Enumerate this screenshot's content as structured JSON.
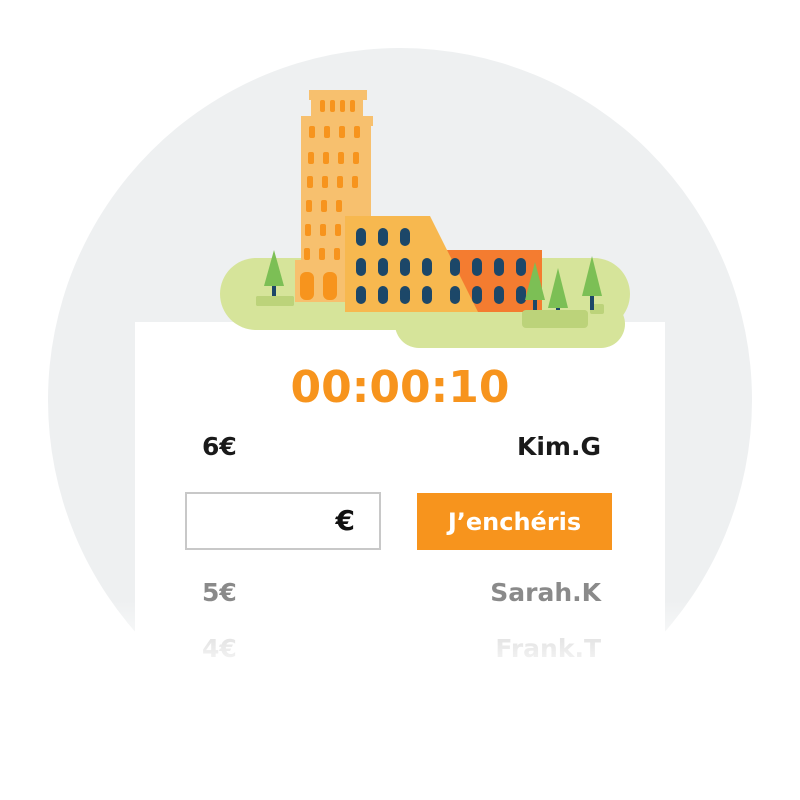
{
  "auction": {
    "timer": "00:00:10",
    "current_bid": {
      "amount": "6€",
      "user": "Kim.G"
    },
    "input": {
      "value": "",
      "currency": "€"
    },
    "submit_label": "J’enchéris",
    "history": [
      {
        "amount": "5€",
        "user": "Sarah.K"
      },
      {
        "amount": "4€",
        "user": "Frank.T"
      }
    ]
  },
  "colors": {
    "accent": "#f7941d",
    "background_circle": "#eef0f1",
    "input_border": "#c8c8c8",
    "history_text": "#8a8a8a",
    "history_text_faded": "#c4c4c4"
  },
  "illustration": {
    "subject": "leaning-tower-and-colosseum",
    "icons": [
      "tower-icon",
      "colosseum-icon",
      "tree-icon"
    ]
  }
}
